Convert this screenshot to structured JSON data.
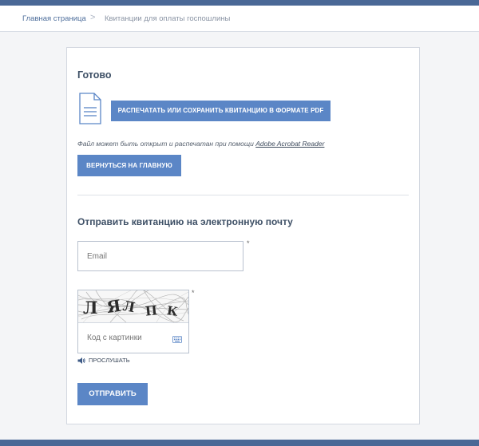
{
  "breadcrumbs": {
    "home": "Главная страница",
    "separator": ">",
    "current": "Квитанции для оплаты госпошлины"
  },
  "done_section": {
    "title": "Готово",
    "pdf_button": "Распечатать или сохранить квитанцию в формате PDF",
    "note_text": "Файл может быть открыт и распечатан при помощи",
    "note_link": "Adobe Acrobat Reader",
    "home_button": "Вернуться на главную"
  },
  "email_section": {
    "title": "Отправить квитанцию на электронную почту",
    "email_placeholder": "Email",
    "required_mark": "*",
    "captcha_placeholder": "Код с картинки",
    "captcha_text": "ЛЯЛПК",
    "listen_label": "ПРОСЛУШАТЬ",
    "send_button": "Отправить"
  },
  "icons": {
    "document": "document-icon",
    "keyboard": "keyboard-icon",
    "speaker": "speaker-icon"
  },
  "colors": {
    "accent": "#5b86c6",
    "header_bar": "#4a6896",
    "link": "#4f6f9c"
  }
}
